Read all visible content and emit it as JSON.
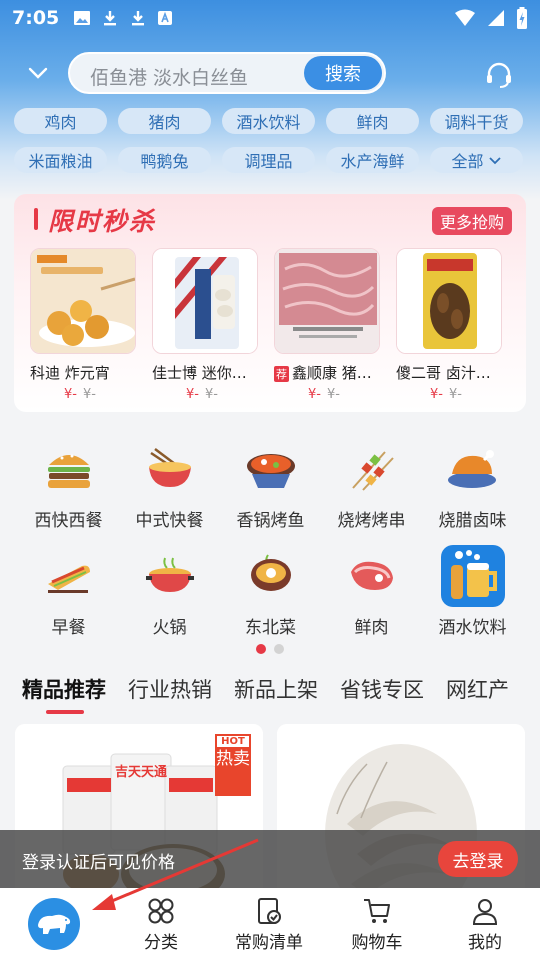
{
  "status_bar": {
    "time": "7:05"
  },
  "search": {
    "placeholder": "佰鱼港 淡水白丝鱼",
    "button": "搜索"
  },
  "chips": [
    "鸡肉",
    "猪肉",
    "酒水饮料",
    "鲜肉",
    "调料干货",
    "米面粮油",
    "鸭鹅兔",
    "调理品",
    "水产海鲜",
    "全部"
  ],
  "flash_sale": {
    "title": "限时秒杀",
    "more": "更多抢购",
    "products": [
      {
        "name": "科迪 炸元宵",
        "tag": "",
        "price": "¥-",
        "old_price": "¥-"
      },
      {
        "name": "佳士博 迷你…",
        "tag": "",
        "price": "¥-",
        "old_price": "¥-"
      },
      {
        "name": "鑫顺康 猪…",
        "tag": "荐",
        "price": "¥-",
        "old_price": "¥-"
      },
      {
        "name": "傻二哥 卤汁…",
        "tag": "",
        "price": "¥-",
        "old_price": "¥-"
      }
    ]
  },
  "categories": [
    {
      "label": "西快西餐",
      "icon": "burger-icon"
    },
    {
      "label": "中式快餐",
      "icon": "noodle-bowl-icon"
    },
    {
      "label": "香锅烤鱼",
      "icon": "hotpot-fish-icon"
    },
    {
      "label": "烧烤烤串",
      "icon": "skewer-icon"
    },
    {
      "label": "烧腊卤味",
      "icon": "roast-chicken-icon"
    },
    {
      "label": "早餐",
      "icon": "sandwich-icon"
    },
    {
      "label": "火锅",
      "icon": "hotpot-icon"
    },
    {
      "label": "东北菜",
      "icon": "stew-pot-icon"
    },
    {
      "label": "鲜肉",
      "icon": "meat-icon"
    },
    {
      "label": "酒水饮料",
      "icon": "beer-icon"
    }
  ],
  "tabs": [
    "精品推荐",
    "行业热销",
    "新品上架",
    "省钱专区",
    "网红产"
  ],
  "feed": {
    "hot_en": "HOT",
    "hot_cn": "热卖",
    "brand": "吉天天通"
  },
  "login": {
    "text": "登录认证后可见价格",
    "button": "去登录"
  },
  "bottom_nav": {
    "items": [
      "分类",
      "常购清单",
      "购物车",
      "我的"
    ]
  },
  "colors": {
    "accent_red": "#e63946",
    "primary_blue": "#3b8fe4"
  }
}
